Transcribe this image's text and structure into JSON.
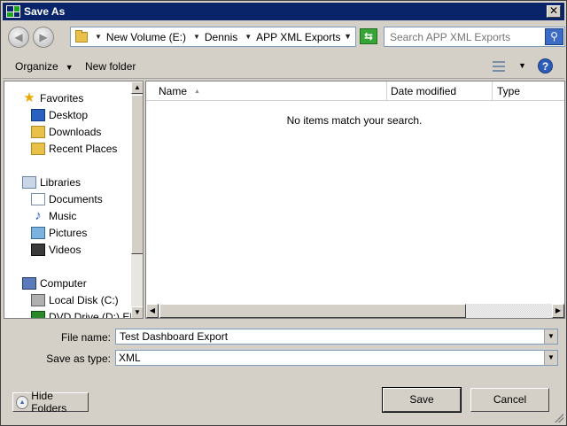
{
  "window": {
    "title": "Save As",
    "close_symbol": "✕"
  },
  "address": {
    "crumbs": [
      "New Volume (E:)",
      "Dennis",
      "APP XML Exports"
    ],
    "arrow_symbol": "▼",
    "search_placeholder": "Search APP XML Exports"
  },
  "toolbar": {
    "organize_label": "Organize",
    "new_folder_label": "New folder",
    "help_symbol": "?"
  },
  "nav_tree": {
    "items": [
      {
        "label": "Favorites",
        "icon": "star-icon"
      },
      {
        "label": "Desktop",
        "icon": "desktop-icon"
      },
      {
        "label": "Downloads",
        "icon": "downloads-folder-icon"
      },
      {
        "label": "Recent Places",
        "icon": "recent-places-icon"
      },
      {
        "label": "Libraries",
        "icon": "libraries-icon"
      },
      {
        "label": "Documents",
        "icon": "documents-icon"
      },
      {
        "label": "Music",
        "icon": "music-icon"
      },
      {
        "label": "Pictures",
        "icon": "pictures-icon"
      },
      {
        "label": "Videos",
        "icon": "videos-icon"
      },
      {
        "label": "Computer",
        "icon": "computer-icon"
      },
      {
        "label": "Local Disk (C:)",
        "icon": "local-disk-icon"
      },
      {
        "label": "DVD Drive (D:) ENI",
        "icon": "dvd-drive-icon"
      }
    ]
  },
  "file_list": {
    "columns": [
      "Name",
      "Date modified",
      "Type"
    ],
    "sort_indicator": "▲",
    "empty_message": "No items match your search."
  },
  "form": {
    "file_name_label": "File name:",
    "file_name_value": "Test Dashboard Export",
    "save_type_label": "Save as type:",
    "save_type_value": "XML"
  },
  "buttons": {
    "hide_folders": "Hide Folders",
    "save": "Save",
    "cancel": "Cancel"
  },
  "colors": {
    "titlebar": "#0a246a",
    "dialog_face": "#d4d0c8",
    "accent_green": "#37a437",
    "search_blue": "#3b6bc4"
  }
}
